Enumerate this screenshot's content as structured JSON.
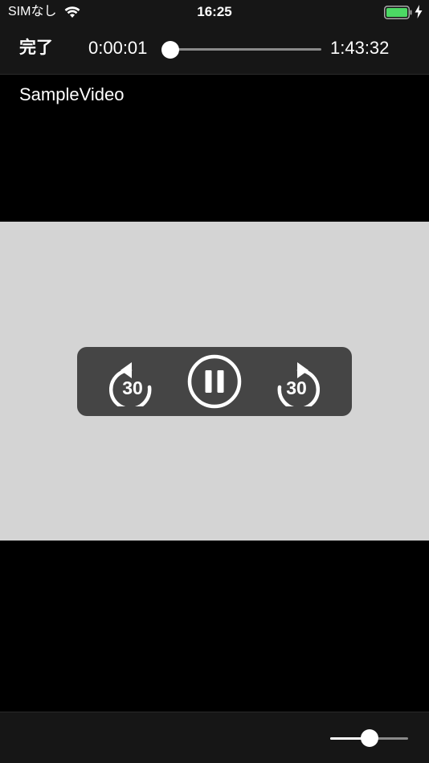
{
  "status_bar": {
    "carrier": "SIMなし",
    "time": "16:25",
    "wifi_icon": "wifi-icon",
    "battery_icon": "battery-icon",
    "battery_color": "#4cd964",
    "charging_icon": "charging-bolt-icon"
  },
  "top_bar": {
    "done_label": "完了",
    "elapsed": "0:00:01",
    "total": "1:43:32",
    "progress": 0.0
  },
  "video": {
    "title": "SampleVideo",
    "background_color": "#d4d4d4"
  },
  "controls": {
    "skip_back_icon": "skip-back-30-icon",
    "skip_back_seconds": "30",
    "pause_icon": "pause-icon",
    "skip_forward_icon": "skip-forward-30-icon",
    "skip_forward_seconds": "30"
  },
  "bottom_bar": {
    "volume": 0.5
  }
}
